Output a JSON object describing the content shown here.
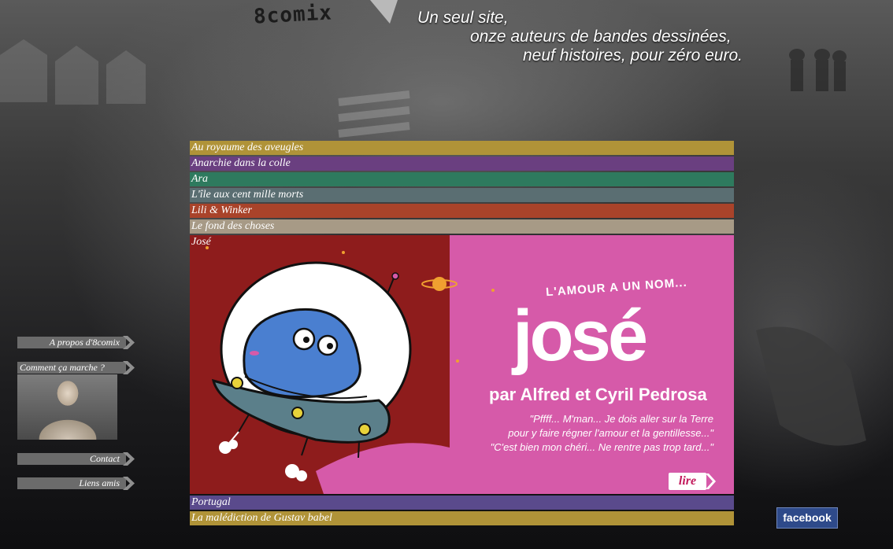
{
  "site": {
    "logo": "8comix",
    "tagline": [
      "Un seul site,",
      "onze auteurs de bandes dessinées,",
      "neuf histoires, pour zéro euro."
    ]
  },
  "menu": {
    "items": [
      {
        "label": "Au royaume des aveugles",
        "color": "#b09338"
      },
      {
        "label": "Anarchie dans la colle",
        "color": "#6a3f80"
      },
      {
        "label": "Ara",
        "color": "#2e7a5e"
      },
      {
        "label": "L'île aux cent mille morts",
        "color": "#5a6e72"
      },
      {
        "label": "Lili & Winker",
        "color": "#a9432a"
      },
      {
        "label": "Le fond des choses",
        "color": "#a79a86"
      }
    ],
    "active": {
      "label": "José",
      "panel": {
        "heading": "L'AMOUR A UN NOM...",
        "name": "josé",
        "byline": "par Alfred et Cyril Pedrosa",
        "quote": [
          "\"Pffff... M'man... Je dois aller sur la Terre",
          "pour y faire régner l'amour et la gentillesse...\"",
          "\"C'est bien mon chéri... Ne rentre pas trop tard...\""
        ],
        "read_button": "lire"
      }
    },
    "items_after": [
      {
        "label": "Portugal",
        "color": "#5a4a8c"
      },
      {
        "label": "La malédiction de Gustav babel",
        "color": "#b09338"
      }
    ]
  },
  "sidebar": {
    "about": "A propos d'8comix",
    "how": "Comment ça marche ?",
    "contact": "Contact",
    "links": "Liens amis"
  },
  "social": {
    "facebook": "facebook"
  }
}
